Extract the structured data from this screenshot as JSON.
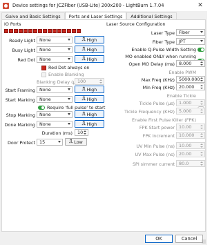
{
  "window": {
    "title": "Device settings for JCZFiber (USB-Lite) 200x200 - LightBurn 1.7.04",
    "close_icon": "close-icon"
  },
  "tabs": [
    {
      "label": "Galvo and Basic Settings"
    },
    {
      "label": "Ports and Laser Settings",
      "active": true
    },
    {
      "label": "Additional Settings"
    }
  ],
  "io": {
    "title": "IO Ports",
    "led_count": 16,
    "led_color": "#c8281e",
    "rows": {
      "ready_light": {
        "label": "Ready Light",
        "value": "None",
        "button": "High"
      },
      "busy_light": {
        "label": "Busy Light",
        "value": "None",
        "button": "High"
      },
      "red_dot": {
        "label": "Red Dot",
        "value": "None",
        "button": "High"
      },
      "start_framing": {
        "label": "Start Framing",
        "value": "None",
        "button": "High"
      },
      "start_marking": {
        "label": "Start Marking",
        "value": "None",
        "button": "High"
      },
      "stop_marking": {
        "label": "Stop Marking",
        "value": "None",
        "button": "High"
      },
      "done_marking": {
        "label": "Done Marking",
        "value": "None",
        "button": "High"
      },
      "door_protect": {
        "label": "Door Protect",
        "value": "15",
        "button": "Low"
      }
    },
    "red_dot_always_on": {
      "label": "Red Dot always on",
      "checked": true
    },
    "enable_blanking": {
      "label": "Enable Blanking",
      "checked": false
    },
    "blanking_delay": {
      "label": "Blanking Delay (µs)",
      "value": "100"
    },
    "require_full_pulse": {
      "label": "Require 'full pulse' to start",
      "on": true
    },
    "duration": {
      "label": "Duration (ms)",
      "value": "10"
    }
  },
  "laser": {
    "title": "Laser Source Configuration",
    "laser_type": {
      "label": "Laser Type",
      "value": "Fiber"
    },
    "fiber_type": {
      "label": "Fiber Type",
      "value": "JPT"
    },
    "qpulse": {
      "label": "Enable Q-Pulse Width Setting",
      "on": true
    },
    "mo_enabled": {
      "label": "MO enabled ONLY when running",
      "on": true
    },
    "open_mo_delay": {
      "label": "Open MO Delay (ms)",
      "value": "8.000"
    },
    "enable_pwm": {
      "label": "Enable PWM",
      "on": false
    },
    "max_freq": {
      "label": "Max Freq (KHz)",
      "value": "5000.000"
    },
    "min_freq": {
      "label": "Min Freq (KHz)",
      "value": "20.000"
    },
    "enable_tickle": {
      "label": "Enable Tickle",
      "on": false
    },
    "tickle_pulse": {
      "label": "Tickle Pulse (µs)",
      "value": "1.000"
    },
    "tickle_freq": {
      "label": "Tickle Frequency (KHz)",
      "value": "5.000"
    },
    "first_pulse_killer": {
      "label": "Enable First Pulse Killer (FPK)",
      "on": false
    },
    "fpk_start": {
      "label": "FPK Start power",
      "value": "10.00"
    },
    "fpk_increment": {
      "label": "FPK Increment",
      "value": "10.000"
    },
    "uv_min": {
      "label": "UV Min Pulse (ns)",
      "value": "10.00"
    },
    "uv_max": {
      "label": "UV Max Pulse (ns)",
      "value": "20.00"
    },
    "spi_current": {
      "label": "SPI simmer current",
      "value": "80.0"
    }
  },
  "footer": {
    "ok": "OK",
    "cancel": "Cancel"
  }
}
